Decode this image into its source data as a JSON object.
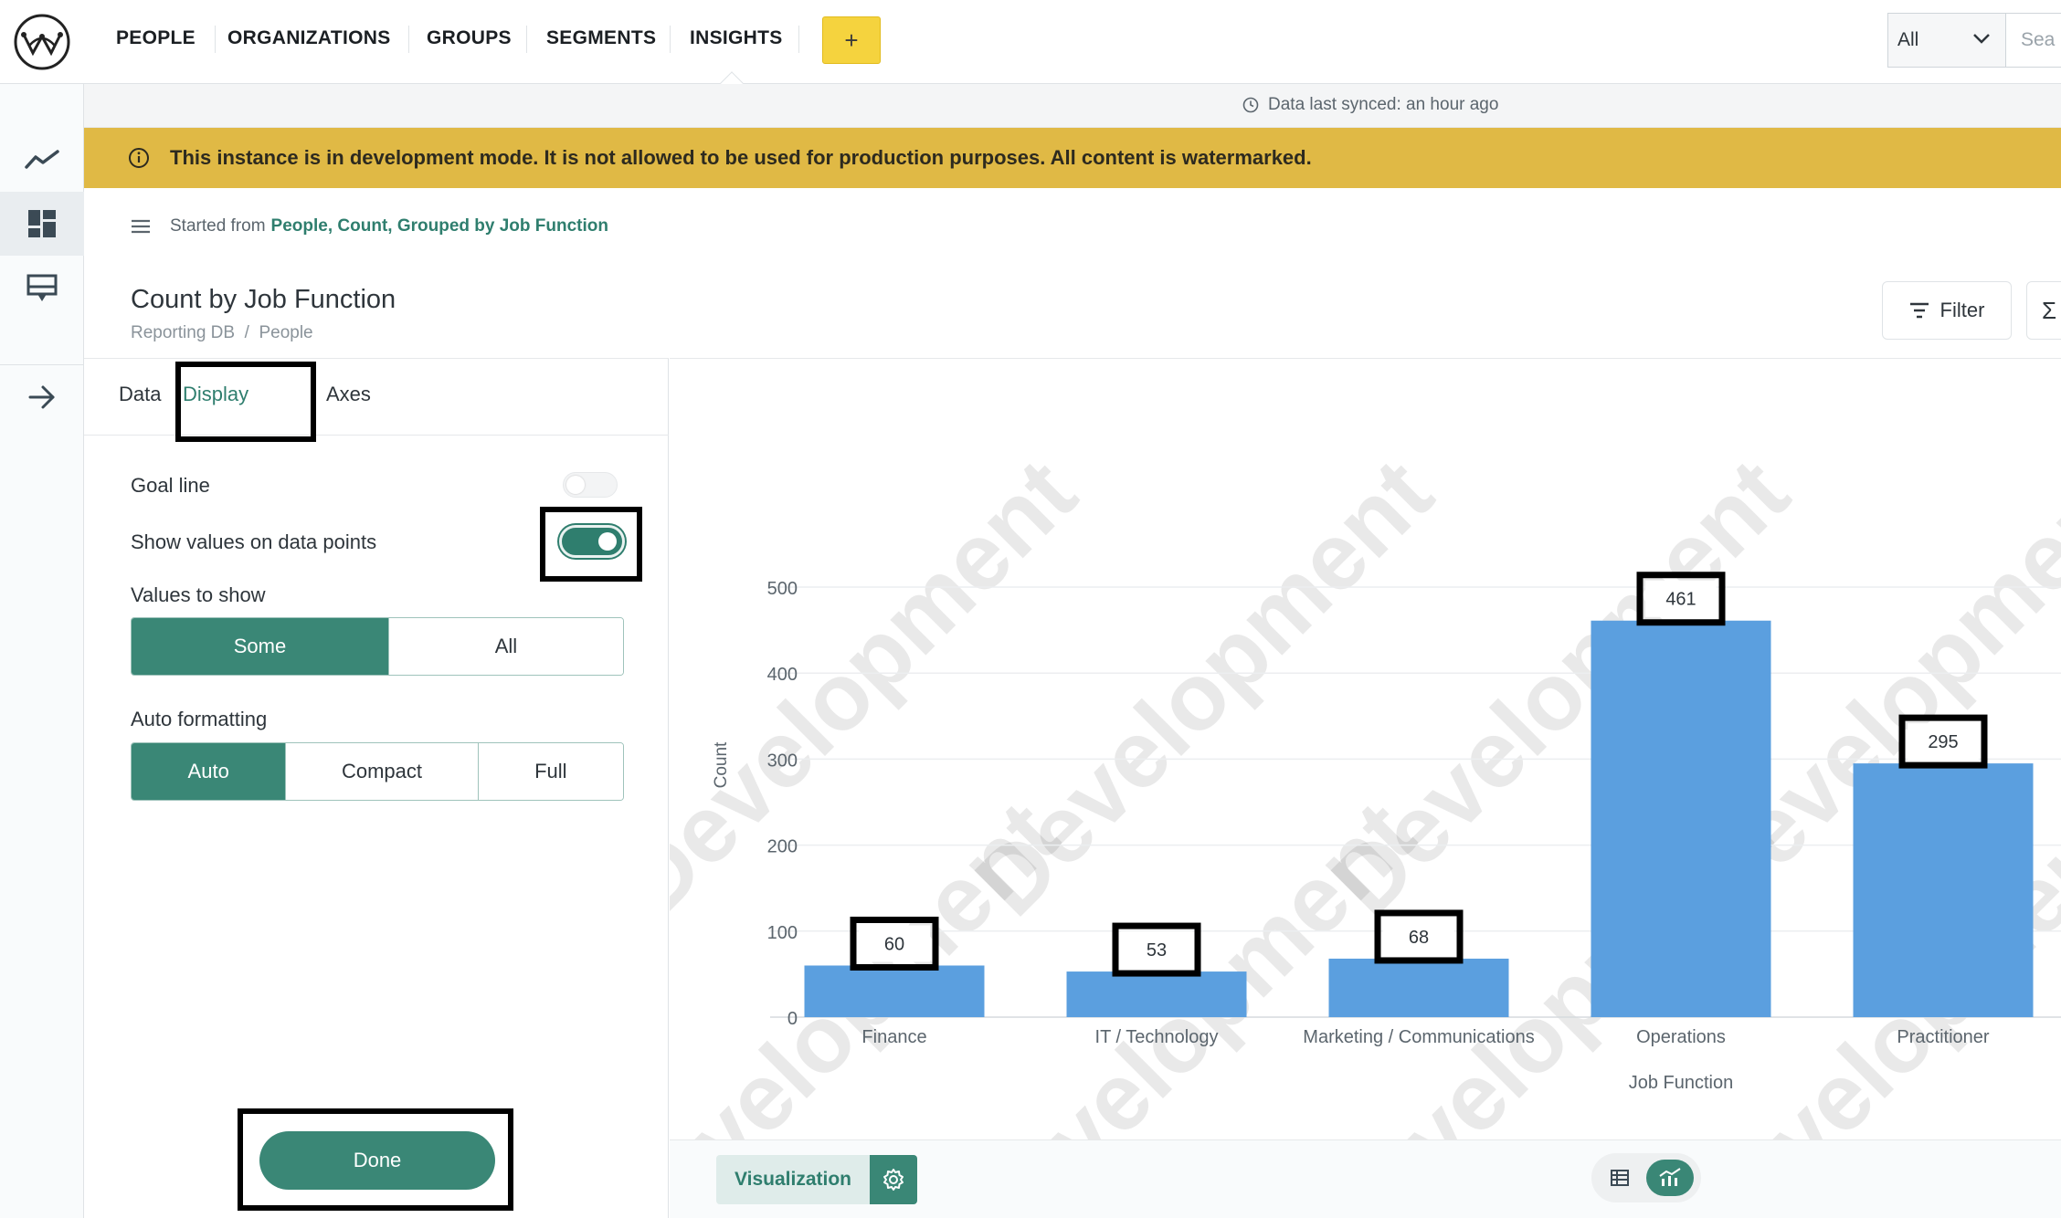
{
  "nav": {
    "links": [
      "PEOPLE",
      "ORGANIZATIONS",
      "GROUPS",
      "SEGMENTS",
      "INSIGHTS"
    ],
    "add_label": "+",
    "scope_value": "All",
    "search_placeholder": "Sea"
  },
  "sync": {
    "text": "Data last synced: an hour ago"
  },
  "banner": {
    "text": "This instance is in development mode. It is not allowed to be used for production purposes. All content is watermarked."
  },
  "question": {
    "started_from_prefix": "Started from",
    "started_from_link": "People, Count, Grouped by Job Function",
    "title": "Count by Job Function",
    "breadcrumb": "Reporting DB  /  People",
    "filter_label": "Filter",
    "summarize_symbol": "Σ"
  },
  "settings": {
    "tabs": [
      "Data",
      "Display",
      "Axes"
    ],
    "active_tab": "Display",
    "goal_line_label": "Goal line",
    "goal_line_on": false,
    "show_values_label": "Show values on data points",
    "show_values_on": true,
    "values_to_show_label": "Values to show",
    "values_to_show_options": [
      "Some",
      "All"
    ],
    "values_to_show_selected": "Some",
    "auto_formatting_label": "Auto formatting",
    "auto_formatting_options": [
      "Auto",
      "Compact",
      "Full"
    ],
    "auto_formatting_selected": "Auto",
    "done_label": "Done"
  },
  "footer": {
    "visualization_label": "Visualization"
  },
  "watermark": "Development",
  "colors": {
    "accent": "#3a8776",
    "bar": "#5b9fdf",
    "banner": "#e0b945",
    "highlight": "#000000"
  },
  "chart_data": {
    "type": "bar",
    "categories": [
      "Finance",
      "IT / Technology",
      "Marketing / Communications",
      "Operations",
      "Practitioner"
    ],
    "values": [
      60,
      53,
      68,
      461,
      295
    ],
    "xlabel": "Job Function",
    "ylabel": "Count",
    "ylim": [
      0,
      500
    ],
    "yticks": [
      0,
      100,
      200,
      300,
      400,
      500
    ],
    "show_values": true,
    "grid": true
  }
}
